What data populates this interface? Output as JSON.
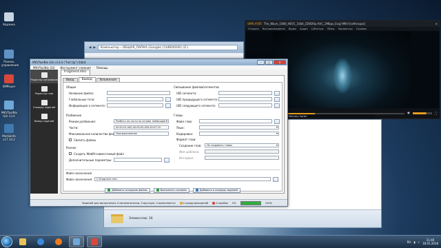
{
  "desktop": {
    "icons": [
      {
        "label": "Корзина",
        "color": "#c7d5e2"
      },
      {
        "label": "Панель управления",
        "color": "#5f93c6"
      },
      {
        "label": "SMPlayer",
        "color": "#d9463a"
      },
      {
        "label": "MKVToolNix GUI 13.0",
        "color": "#6ea8d8"
      },
      {
        "label": "MediaInfo v17.10.2",
        "color": "#3f7ab0"
      }
    ]
  },
  "explorer": {
    "address": "Компьютер › ОБЩАЯ_ПАПКА (Google) (\\\\VBOXSVR) (Z:)",
    "items_count": "Элементов: 16"
  },
  "player": {
    "app_name": "SMPLAYER",
    "window_title": "The_Wave_1080_HEVC_10bit_[DVDRip-AVC_2Mbps_Eng]-MKV-[selfsnopia]",
    "menu": [
      "Открыть",
      "Воспроизведение",
      "Видео",
      "Аудио",
      "Субтитры",
      "Обзор",
      "Параметры",
      "Справка"
    ],
    "song_text": "Dj Memory Sarte!"
  },
  "app": {
    "title": "MKVToolNix GUI v13.0 (\"Full Up\") 64bit",
    "menu": [
      "MKVToolNix GUI",
      "Инструмент слияния",
      "Помощь"
    ],
    "sidebar": [
      {
        "label": "Редактор заголовков",
        "color": "#e8e8e8"
      },
      {
        "label": "Редактор глав",
        "color": "#e8e8e8"
      },
      {
        "label": "Очередь заданий",
        "color": "#e8e8e8"
      },
      {
        "label": "Вывод заданий",
        "color": "#e8e8e8"
      }
    ],
    "top_tab": "Fragment.mkv",
    "tabs": [
      "Ввод",
      "Вывод",
      "Вложения"
    ],
    "active_tab": "Вывод",
    "general": {
      "group": "Общие",
      "file_title": "Название файла:",
      "global_tags": "Глобальные теги:",
      "segment_info": "Информация о сегменте:"
    },
    "splitting": {
      "group": "Разбиение",
      "mode_label": "Режим разбиения:",
      "mode_value": "Разбить на части на основе таймкодов",
      "parts_label": "Части:",
      "parts_value": "00:01:02.000,00:05:05.000,00:07:10",
      "max_files_label": "Максимальное количество файлов:",
      "max_files_value": "Неограниченное",
      "link_files": "Связать файлы"
    },
    "misc": {
      "group": "Разное",
      "webm": "Создать WebM-совместимый файл",
      "extra_params": "Дополнительные параметры:"
    },
    "segments": {
      "group": "Связывание файлов/сегментов",
      "uid": "UID сегмента:",
      "prev_uid": "UID предыдущего сегмента:",
      "next_uid": "UID следующего сегмента:"
    },
    "chapters": {
      "group": "Главы",
      "file": "Файл глав:",
      "language": "Язык:",
      "charset": "Кодировка:",
      "gen_group": "Формат глав:",
      "creation_label": "Создание глав:",
      "creation_value": "Не создавать главы",
      "name_label": "Имя шаблона:",
      "interval_label": "Интервал:"
    },
    "output": {
      "group": "Файл назначения",
      "label": "Файл назначения:",
      "value": "C:\\Fragment.mkv"
    },
    "actions": {
      "add_source": "Добавить исходные файлы",
      "start": "Выполнить слияние",
      "add_queue": "Добавить в очередь заданий"
    },
    "status": {
      "jobs": "Заданий для выполнения: 0 автоматически, 0 вручную, 0 выполняется",
      "warnings": "0 предупреждений",
      "errors": "0 ошибок",
      "progress_label": "0%",
      "progress": 1.0,
      "progress_right": "100%"
    }
  },
  "taskbar": {
    "apps": [
      {
        "name": "explorer",
        "color": "#e8c25a"
      },
      {
        "name": "ie",
        "color": "#3b8ad9"
      },
      {
        "name": "media",
        "color": "#ec7b22"
      },
      {
        "name": "mkvtoolnix",
        "color": "#6ea8d8"
      },
      {
        "name": "smplayer",
        "color": "#d9463a"
      }
    ],
    "lang": "RU",
    "time": "11:40",
    "date": "18.01.2018"
  },
  "colors": {
    "accent": "#2fae3d",
    "close": "#c9463d"
  }
}
